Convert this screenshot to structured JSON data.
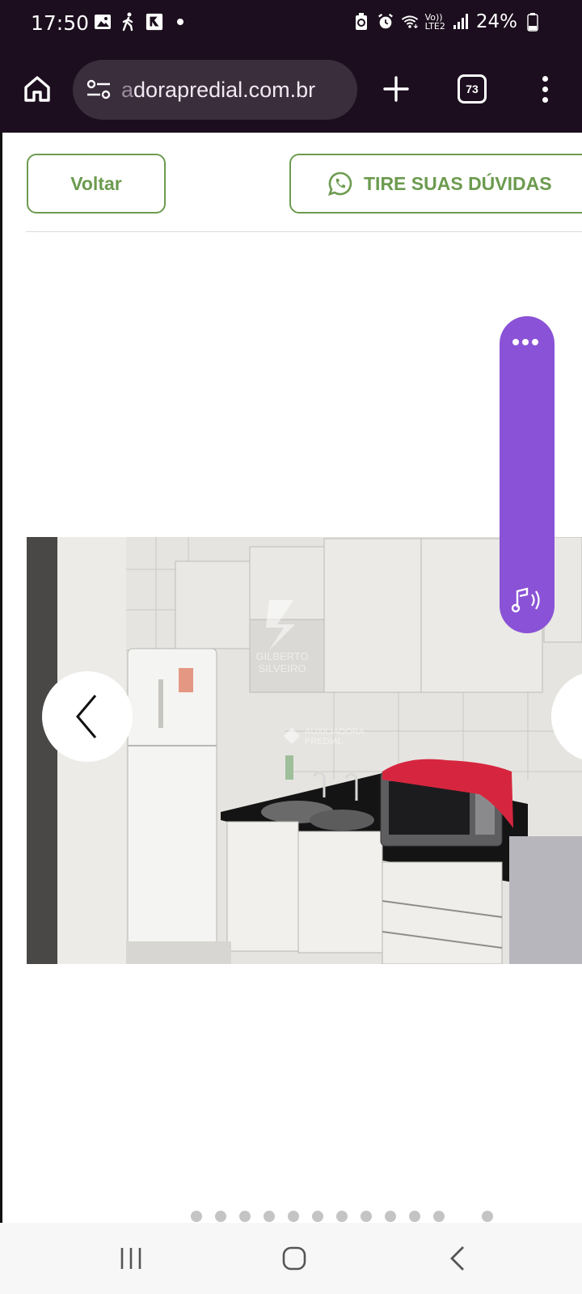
{
  "status_bar": {
    "time": "17:50",
    "battery": "24%",
    "network": "LTE2",
    "volte": "Vo))"
  },
  "browser": {
    "url_faded": "a",
    "url_main": "dorapredial.com.br",
    "tab_count": "73"
  },
  "page": {
    "back_button": "Voltar",
    "questions_button": "TIRE SUAS DÚVIDAS",
    "accent_color": "#6c9b4f",
    "audio_widget_color": "#8a52d6"
  },
  "photo": {
    "watermark_top_line": "GILBERTO",
    "watermark_bottom_line": "SILVEIRO",
    "watermark2_line1": "AUXILIADORA",
    "watermark2_line2": "PREDIAL"
  },
  "carousel": {
    "dot_count": 13
  }
}
